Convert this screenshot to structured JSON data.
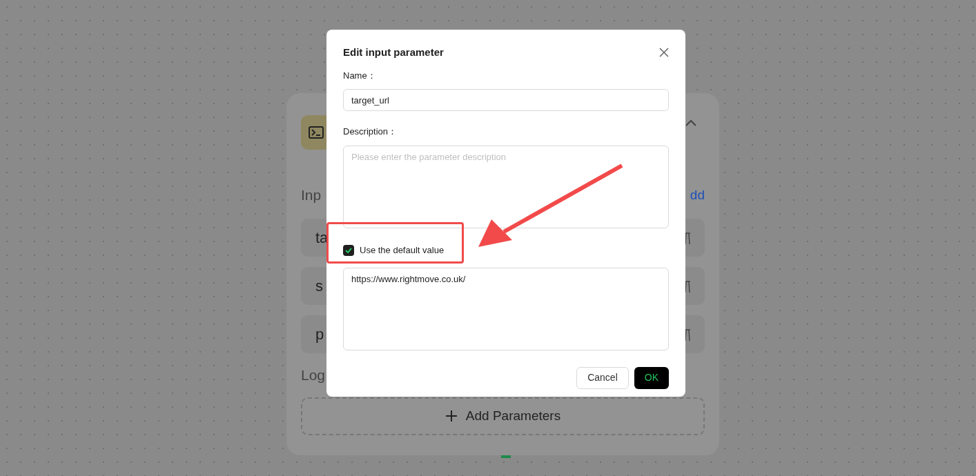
{
  "background_card": {
    "section_label": "Inp",
    "add_link": "dd",
    "rows": [
      "ta",
      "s",
      "p"
    ],
    "logs_label": "Log",
    "add_button": "Add Parameters"
  },
  "dialog": {
    "title": "Edit input parameter",
    "name_label": "Name：",
    "name_value": "target_url",
    "description_label": "Description：",
    "description_placeholder": "Please enter the parameter description",
    "default_checkbox": {
      "label": "Use the default value",
      "checked": true
    },
    "default_value": "https://www.rightmove.co.uk/",
    "buttons": [
      {
        "label": "Cancel",
        "kind": "secondary"
      },
      {
        "label": "OK",
        "kind": "primary"
      }
    ]
  }
}
